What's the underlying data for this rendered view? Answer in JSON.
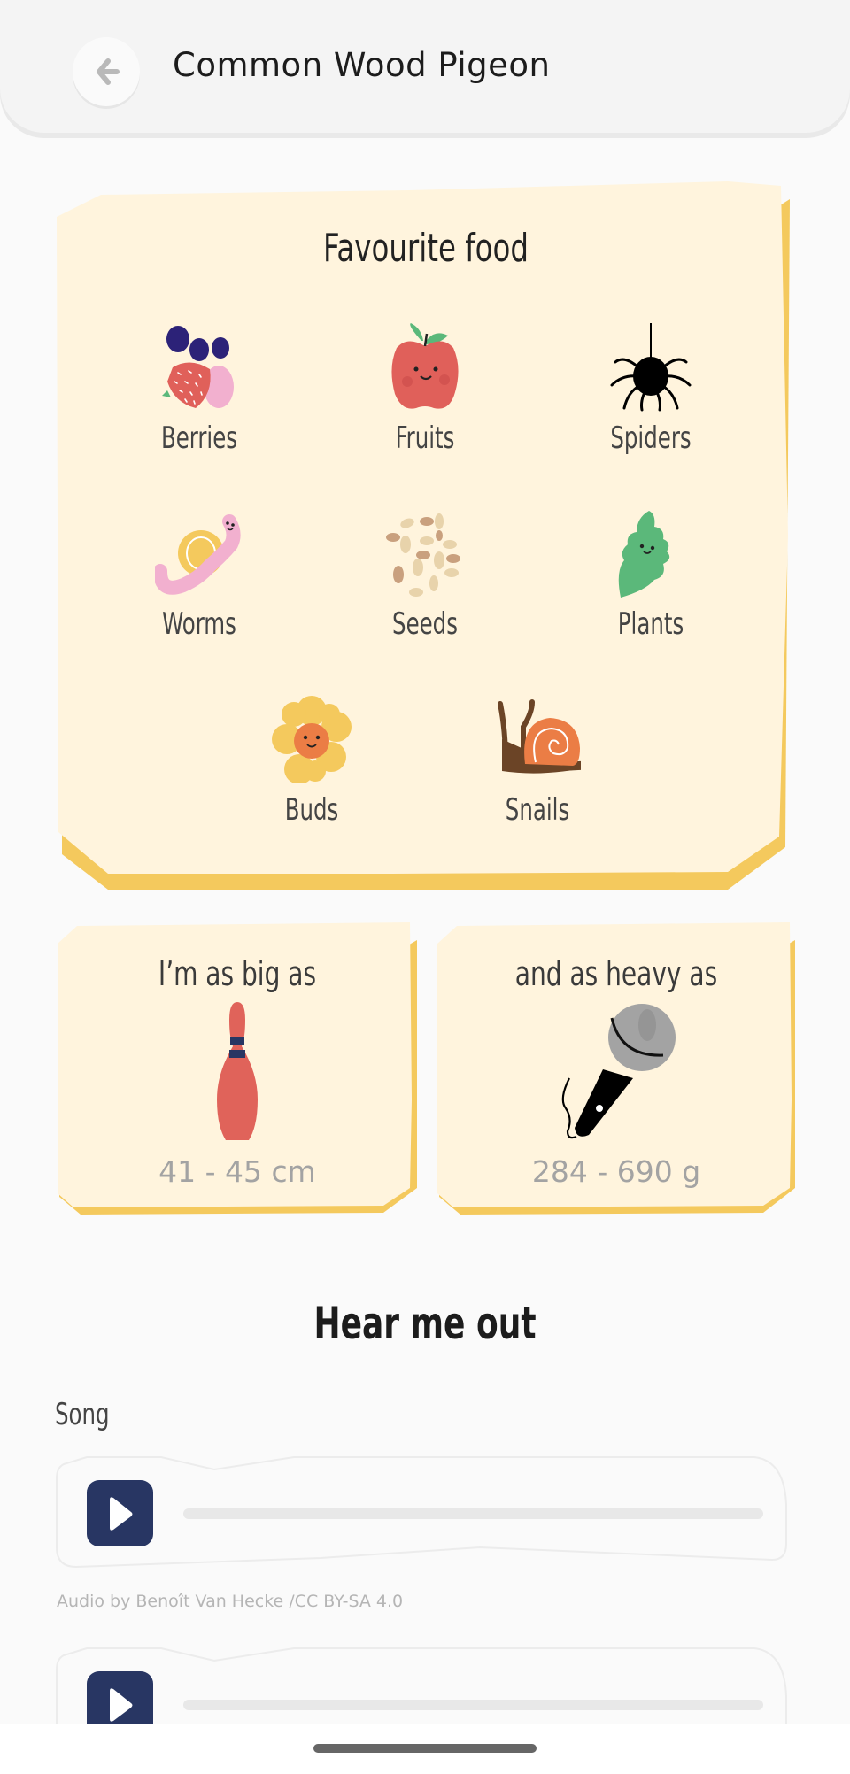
{
  "header": {
    "title": "Common Wood Pigeon",
    "back_icon": "arrow-left-icon"
  },
  "favourite_food": {
    "title": "Favourite food",
    "items": [
      {
        "label": "Berries",
        "icon": "berries-icon"
      },
      {
        "label": "Fruits",
        "icon": "apple-icon"
      },
      {
        "label": "Spiders",
        "icon": "spider-icon"
      },
      {
        "label": "Worms",
        "icon": "worm-icon"
      },
      {
        "label": "Seeds",
        "icon": "seeds-icon"
      },
      {
        "label": "Plants",
        "icon": "leaf-icon"
      },
      {
        "label": "Buds",
        "icon": "flower-icon"
      },
      {
        "label": "Snails",
        "icon": "snail-icon"
      }
    ]
  },
  "size": {
    "heading": "I’m as big as",
    "comparison_icon": "bowling-pin-icon",
    "value": "41 - 45 cm"
  },
  "weight": {
    "heading": "and as heavy as",
    "comparison_icon": "microphone-icon",
    "value": "284 - 690 g"
  },
  "audio_section": {
    "title": "Hear me out",
    "song_label": "Song",
    "players": [
      {
        "play_icon": "play-icon",
        "progress": 0
      },
      {
        "play_icon": "play-icon",
        "progress": 0
      }
    ],
    "attribution": {
      "audio_link": "Audio",
      "by_text": " by Benoît Van Hecke /",
      "license_link": "CC BY-SA 4.0"
    }
  },
  "colors": {
    "card_bg": "#fff4dd",
    "card_shadow": "#f4c95d",
    "play_button": "#283663",
    "header_bg": "#f4f4f4"
  }
}
